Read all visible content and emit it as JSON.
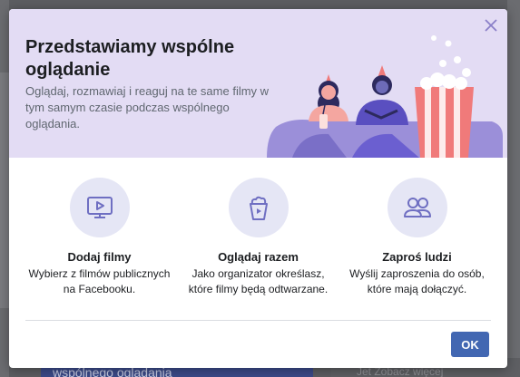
{
  "dialog": {
    "title": "Przedstawiamy wspólne oglądanie",
    "description": "Oglądaj, rozmawiaj i reaguj na te same filmy w tym samym czasie podczas wspólnego oglądania.",
    "close_icon": "close-icon",
    "ok_label": "OK"
  },
  "features": [
    {
      "icon": "video-screen-icon",
      "title": "Dodaj filmy",
      "description": "Wybierz z filmów publicznych na Facebooku."
    },
    {
      "icon": "popcorn-play-icon",
      "title": "Oglądaj razem",
      "description": "Jako organizator określasz, które filmy będą odtwarzane."
    },
    {
      "icon": "people-icon",
      "title": "Zaproś ludzi",
      "description": "Wyślij zaproszenia do osób, które mają dołączyć."
    }
  ],
  "background": {
    "card_text": "wspólnego oglądania",
    "right_text": "Jet   Zobacz więcej"
  },
  "colors": {
    "hero_bg": "#e3dcf4",
    "accent": "#4267b2",
    "icon_circle": "#e5e6f5",
    "icon_stroke": "#6f6fc2"
  }
}
